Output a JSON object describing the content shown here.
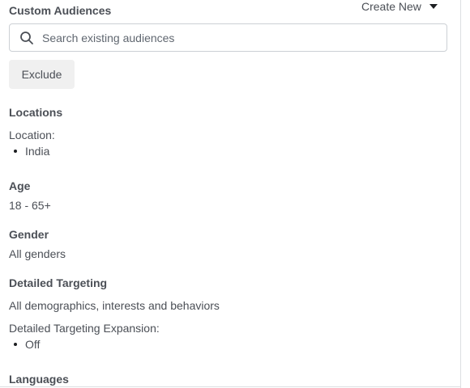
{
  "custom_audiences": {
    "heading": "Custom Audiences",
    "create_new_label": "Create New",
    "search_placeholder": "Search existing audiences",
    "exclude_label": "Exclude"
  },
  "locations": {
    "heading": "Locations",
    "label": "Location:",
    "items": [
      "India"
    ]
  },
  "age": {
    "heading": "Age",
    "value": "18 - 65+"
  },
  "gender": {
    "heading": "Gender",
    "value": "All genders"
  },
  "detailed_targeting": {
    "heading": "Detailed Targeting",
    "value": "All demographics, interests and behaviors",
    "expansion_label": "Detailed Targeting Expansion:",
    "expansion_items": [
      "Off"
    ]
  },
  "languages": {
    "heading": "Languages"
  }
}
